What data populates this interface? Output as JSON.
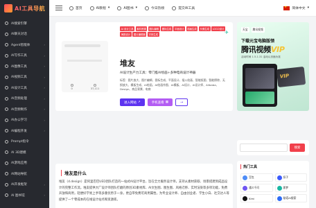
{
  "brand": {
    "logo_text": "AI工具导航"
  },
  "sidebar": {
    "items": [
      {
        "label": "AI搜索引擎",
        "has_caret": false
      },
      {
        "label": "AI聊天对话",
        "has_caret": false
      },
      {
        "label": "Agent智能体",
        "has_caret": true
      },
      {
        "label": "AI写作工具",
        "has_caret": true
      },
      {
        "label": "AI图像工具",
        "has_caret": true
      },
      {
        "label": "AI视频工具",
        "has_caret": true
      },
      {
        "label": "AI设计工具",
        "has_caret": true
      },
      {
        "label": "AI音频处理",
        "has_caret": true
      },
      {
        "label": "AI音频制作",
        "has_caret": true
      },
      {
        "label": "AI办公学习",
        "has_caret": true
      },
      {
        "label": "AI编程开发",
        "has_caret": true
      },
      {
        "label": "Prompt指令",
        "has_caret": false
      },
      {
        "label": "AI 3D建模",
        "has_caret": false
      },
      {
        "label": "AI游戏应用",
        "has_caret": false
      },
      {
        "label": "AI网站导航",
        "has_caret": false
      },
      {
        "label": "AI开发框架",
        "has_caret": true
      },
      {
        "label": "AI 图书馆",
        "has_caret": true
      }
    ]
  },
  "topbar": {
    "links": [
      {
        "label": "首页",
        "icon": "home-icon"
      },
      {
        "label": "AI教程",
        "icon": "book-icon",
        "caret": "▾"
      },
      {
        "label": "AI图书",
        "icon": "book-icon",
        "caret": "▾"
      },
      {
        "label": "今日热榜",
        "icon": "fire-icon"
      },
      {
        "label": "提交AI工具",
        "icon": "send-icon"
      }
    ],
    "language": "简体中文",
    "language_caret": "▾"
  },
  "tool": {
    "tags": [
      "AI 设计工具",
      "素材资源",
      "图片编辑",
      "图标生成",
      "平面设计",
      "插画生成",
      "头像生成",
      "LOGO设计",
      "海报设计",
      "图片编辑器",
      "字体生成"
    ],
    "name": "堆友",
    "description": "AI设计生产力工具：零门槛AI绘画+多种电商设计神器",
    "meta": "标签：图片放大、图片编辑、图标生成、平面设计、插入绘画、智能抠图、智能擦除、无损放大、模板生成、AI绘画、AI绘画作图、AI模板、AI设计、AI设计师、Alibaba、Design、商品背景、电商",
    "stats": {
      "likes": "0",
      "views": "37,111"
    },
    "buttons": {
      "primary": "进入网站",
      "secondary": "手机查看",
      "ghost_arrow": "→"
    }
  },
  "ad": {
    "badge1": "天宝",
    "badge2": "腾讯视频",
    "line1": "下载元宝电脑版领",
    "line2": "腾讯视频",
    "vip": "VIP",
    "small": "活动时间 1.5-1.31 活动以页面为准",
    "card_text": "VIP"
  },
  "article": {
    "title": "堆友是什么",
    "body": "堆友（d.design）是阿里巴巴UED团队打造的一站式AI设计平台，旨在全力服务设计师，支持从素材获取、场景搭建到成品设计的完整工作流。堆友提供大厂设计师团队打磨的原创3D素材库、AI文生图、图生图、风格迁移、实时渲染等多项功能，免费开放和商用，轻便好学易上手等多重优势于一身，更自带免费可商用属性，为专业设计师、自由创业者、学生小白、社交达人等提供了一个零成本的在线设计站点和资源库。"
  },
  "search": {
    "placeholder": "",
    "button": "搜索"
  },
  "hot": {
    "title": "热门工具",
    "items": [
      {
        "label": "豆包",
        "color": "#4f8df7"
      },
      {
        "label": "扣子",
        "color": "#3b5bfd"
      },
      {
        "label": "通义千问",
        "color": "#6f55f2"
      },
      {
        "label": "即梦",
        "color": "#18b7a2"
      },
      {
        "label": "Kimi",
        "color": "#111111"
      },
      {
        "label": "秘塔AI搜索",
        "color": "#2d6cf6"
      }
    ]
  },
  "colors": {
    "accent": "#f1404b",
    "primary_button": "#5d33f0",
    "sidebar_bg": "#27292f"
  }
}
